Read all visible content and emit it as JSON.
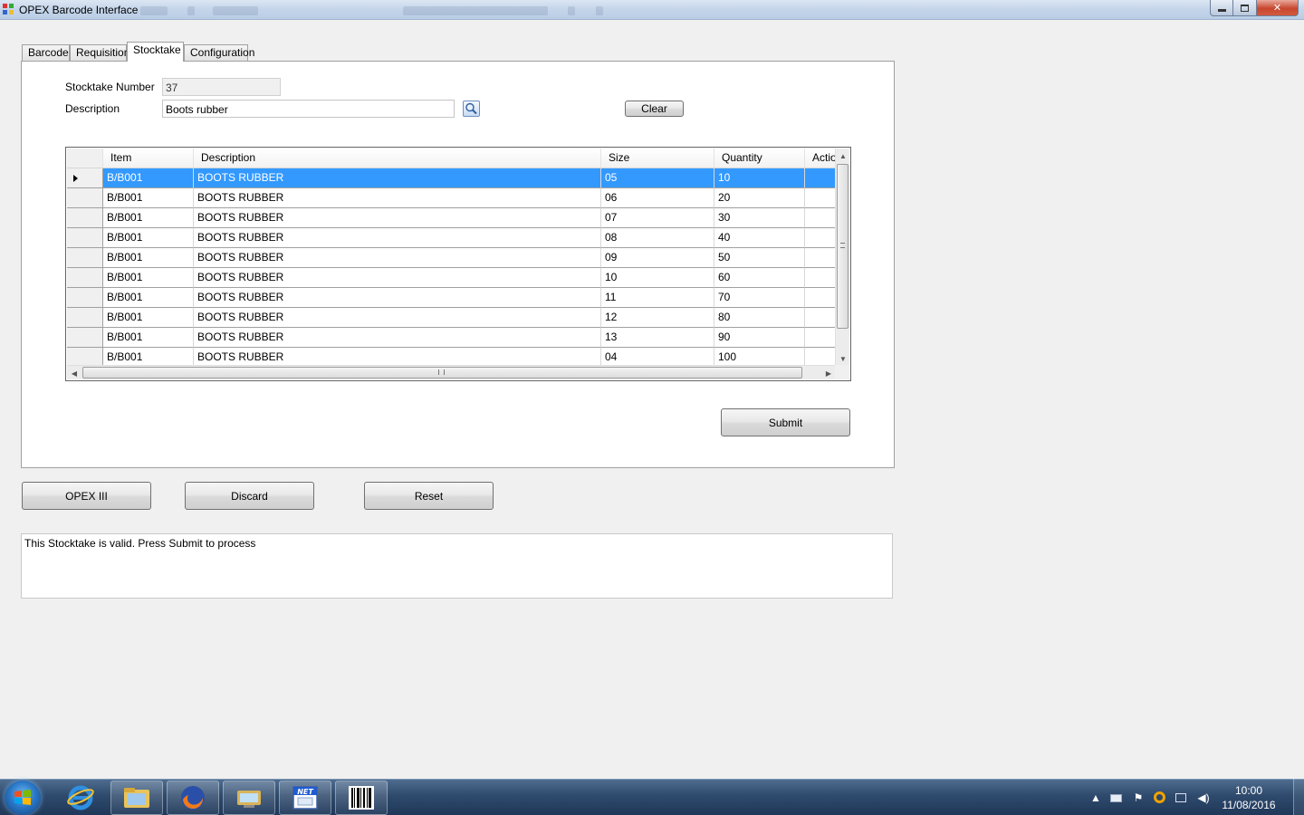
{
  "window": {
    "title": "OPEX Barcode Interface"
  },
  "tabs": [
    {
      "label": "Barcode"
    },
    {
      "label": "Requisition"
    },
    {
      "label": "Stocktake",
      "active": true
    },
    {
      "label": "Configuration"
    }
  ],
  "form": {
    "stocktake_number_label": "Stocktake Number",
    "stocktake_number_value": "37",
    "description_label": "Description",
    "description_value": "Boots rubber",
    "clear_label": "Clear",
    "submit_label": "Submit"
  },
  "grid": {
    "columns": [
      "Item",
      "Description",
      "Size",
      "Quantity",
      "Action"
    ],
    "rows": [
      {
        "item": "B/B001",
        "description": "BOOTS RUBBER",
        "size": "05",
        "quantity": "10",
        "action": ""
      },
      {
        "item": "B/B001",
        "description": "BOOTS RUBBER",
        "size": "06",
        "quantity": "20",
        "action": ""
      },
      {
        "item": "B/B001",
        "description": "BOOTS RUBBER",
        "size": "07",
        "quantity": "30",
        "action": ""
      },
      {
        "item": "B/B001",
        "description": "BOOTS RUBBER",
        "size": "08",
        "quantity": "40",
        "action": ""
      },
      {
        "item": "B/B001",
        "description": "BOOTS RUBBER",
        "size": "09",
        "quantity": "50",
        "action": ""
      },
      {
        "item": "B/B001",
        "description": "BOOTS RUBBER",
        "size": "10",
        "quantity": "60",
        "action": ""
      },
      {
        "item": "B/B001",
        "description": "BOOTS RUBBER",
        "size": "11",
        "quantity": "70",
        "action": ""
      },
      {
        "item": "B/B001",
        "description": "BOOTS RUBBER",
        "size": "12",
        "quantity": "80",
        "action": ""
      },
      {
        "item": "B/B001",
        "description": "BOOTS RUBBER",
        "size": "13",
        "quantity": "90",
        "action": ""
      },
      {
        "item": "B/B001",
        "description": "BOOTS RUBBER",
        "size": "04",
        "quantity": "100",
        "action": ""
      }
    ],
    "selected_row": 0,
    "selection_color": "#3399ff"
  },
  "actions": {
    "opex_label": "OPEX III",
    "discard_label": "Discard",
    "reset_label": "Reset"
  },
  "status": {
    "message": "This Stocktake is valid. Press Submit to process"
  },
  "taskbar": {
    "items": [
      "start-orb",
      "internet-explorer-icon",
      "file-explorer-icon",
      "firefox-icon",
      "remote-desktop-icon",
      "dotnet-app-icon",
      "barcode-app-icon"
    ],
    "clock_time": "10:00",
    "clock_date": "11/08/2016"
  }
}
